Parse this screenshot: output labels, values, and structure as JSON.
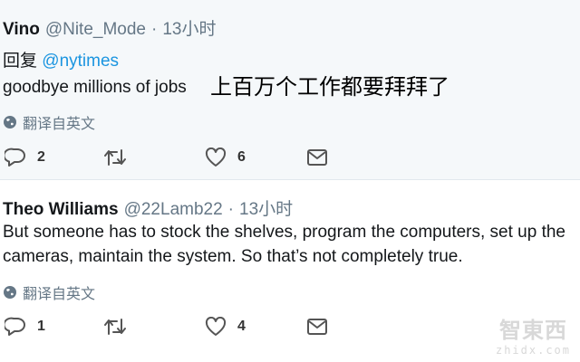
{
  "tweets": [
    {
      "name": "Vino",
      "handle": "@Nite_Mode",
      "time": "13小时",
      "reply_prefix": "回复",
      "reply_to": "@nytimes",
      "text": "goodbye millions of jobs",
      "translate": "翻译自英文",
      "replies": "2",
      "retweets": "",
      "likes": "6"
    },
    {
      "name": "Theo Williams",
      "handle": "@22Lamb22",
      "time": "13小时",
      "text_line1": "But someone has to stock the shelves, program the computers, set up the",
      "text_line2": "cameras, maintain the system.  So that’s not completely true.",
      "translate": "翻译自英文",
      "replies": "1",
      "retweets": "",
      "likes": "4"
    }
  ],
  "annotation": "上百万个工作都要拜拜了",
  "separator": "·",
  "watermark": {
    "logo": "智東西",
    "sub": "zhidx.com"
  },
  "colors": {
    "link": "#1b95e0",
    "meta": "#657786",
    "bg_highlight": "#f5f8fa"
  }
}
